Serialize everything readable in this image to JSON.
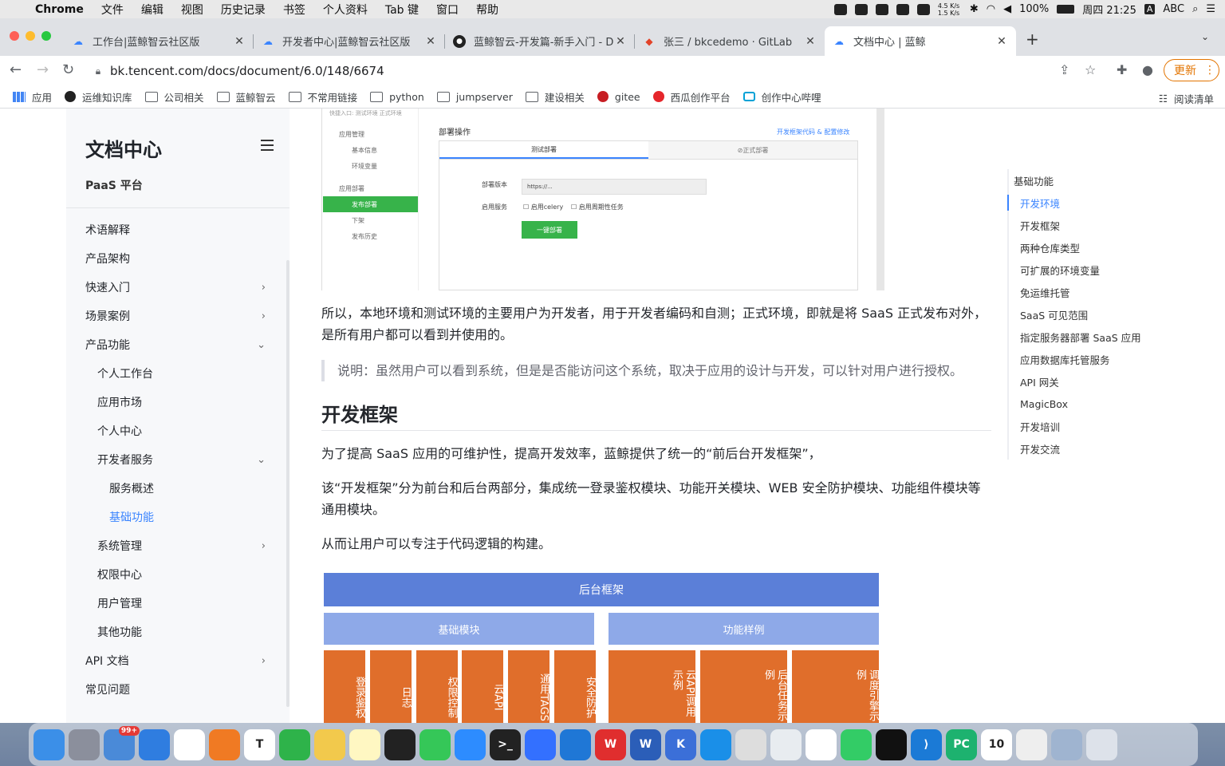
{
  "menubar": {
    "app_name": "Chrome",
    "items": [
      "文件",
      "编辑",
      "视图",
      "历史记录",
      "书签",
      "个人资料",
      "Tab 键",
      "窗口",
      "帮助"
    ],
    "net_speed": "4.5 K/s 1.5 K/s",
    "battery": "100%",
    "clock": "周四 21:25",
    "input_method": "ABC"
  },
  "tabs": [
    {
      "title": "工作台|蓝鲸智云社区版",
      "icon": "cloud-icon"
    },
    {
      "title": "开发者中心|蓝鲸智云社区版",
      "icon": "cloud-icon"
    },
    {
      "title": "蓝鲸智云-开发篇-新手入门 - Dev",
      "icon": "github-icon"
    },
    {
      "title": "张三 / bkcedemo · GitLab",
      "icon": "gitlab-icon"
    },
    {
      "title": "文档中心 | 蓝鲸",
      "icon": "cloud-icon"
    }
  ],
  "toolbar": {
    "url": "bk.tencent.com/docs/document/6.0/148/6674",
    "update_label": "更新"
  },
  "bookmarks": [
    "应用",
    "运维知识库",
    "公司相关",
    "蓝鲸智云",
    "不常用链接",
    "python",
    "jumpserver",
    "建设相关",
    "gitee",
    "西瓜创作平台",
    "创作中心哔哩"
  ],
  "reading_list": "阅读清单",
  "sidebar": {
    "title": "文档中心",
    "subtitle": "PaaS 平台",
    "items": [
      {
        "label": "术语解释",
        "level": 1,
        "chevron": ""
      },
      {
        "label": "产品架构",
        "level": 1,
        "chevron": ""
      },
      {
        "label": "快速入门",
        "level": 1,
        "chevron": "›"
      },
      {
        "label": "场景案例",
        "level": 1,
        "chevron": "›"
      },
      {
        "label": "产品功能",
        "level": 1,
        "chevron": "⌄"
      },
      {
        "label": "个人工作台",
        "level": 2,
        "chevron": ""
      },
      {
        "label": "应用市场",
        "level": 2,
        "chevron": ""
      },
      {
        "label": "个人中心",
        "level": 2,
        "chevron": ""
      },
      {
        "label": "开发者服务",
        "level": 2,
        "chevron": "⌄"
      },
      {
        "label": "服务概述",
        "level": 3,
        "chevron": ""
      },
      {
        "label": "基础功能",
        "level": 3,
        "chevron": "",
        "active": true
      },
      {
        "label": "系统管理",
        "level": 2,
        "chevron": "›"
      },
      {
        "label": "权限中心",
        "level": 2,
        "chevron": ""
      },
      {
        "label": "用户管理",
        "level": 2,
        "chevron": ""
      },
      {
        "label": "其他功能",
        "level": 2,
        "chevron": ""
      },
      {
        "label": "API 文档",
        "level": 1,
        "chevron": "›"
      },
      {
        "label": "常见问题",
        "level": 1,
        "chevron": ""
      }
    ]
  },
  "screenshot": {
    "crumb": "快捷入口:   测试环境   正式环境",
    "left_menu": [
      "应用管理",
      "基本信息",
      "环境变量",
      "应用部署",
      "发布部署",
      "下架",
      "发布历史"
    ],
    "section": "部署操作",
    "link": "开发框架代码 & 配置修改",
    "tab_test": "测试部署",
    "tab_prod": "⊘正式部署",
    "version_label": "部署版本",
    "version_value": "https://...",
    "service_label": "启用服务",
    "celery": "启用celery",
    "periodic": "启用周期性任务",
    "deploy_btn": "一键部署"
  },
  "content": {
    "para1": "所以，本地环境和测试环境的主要用户为开发者，用于开发者编码和自测；正式环境，即就是将 SaaS 正式发布对外，是所有用户都可以看到并使用的。",
    "note": "说明：虽然用户可以看到系统，但是是否能访问这个系统，取决于应用的设计与开发，可以针对用户进行授权。",
    "h2": "开发框架",
    "para2": "为了提高 SaaS 应用的可维护性，提高开发效率，蓝鲸提供了统一的“前后台开发框架”，",
    "para3": "该“开发框架”分为前台和后台两部分，集成统一登录鉴权模块、功能开关模块、WEB 安全防护模块、功能组件模块等通用模块。",
    "para4": "从而让用户可以专注于代码逻辑的构建。"
  },
  "diagram": {
    "top": "后台框架",
    "left": "基础模块",
    "right": "功能样例",
    "left_cols": [
      "登录鉴权",
      "日志",
      "权限控制",
      "云API",
      "通用TAGS",
      "安全防护"
    ],
    "right_cols": [
      "云API调用示例",
      "后台任务示例",
      "调度引擎示例"
    ],
    "colors": {
      "top": "#5b7fd8",
      "sub": "#8ea9e8",
      "col": "#e06e2b"
    }
  },
  "toc": {
    "head": "基础功能",
    "items": [
      "开发环境",
      "开发框架",
      "两种仓库类型",
      "可扩展的环境变量",
      "免运维托管",
      "SaaS 可见范围",
      "指定服务器部署 SaaS 应用",
      "应用数据库托管服务",
      "API 网关",
      "MagicBox",
      "开发培训",
      "开发交流"
    ]
  },
  "dock": [
    "finder-icon",
    "launchpad-icon",
    "qq-icon",
    "safari-icon",
    "chrome-icon",
    "firefox-icon",
    "typora-icon",
    "evernote-icon",
    "photos-icon",
    "notes-icon",
    "qq-penguin-icon",
    "wechat-icon",
    "zoom-icon",
    "terminal-icon",
    "lark-icon",
    "teamviewer-icon",
    "wps-icon",
    "word-icon",
    "k-icon",
    "tool-icon",
    "textedit-icon",
    "disk-icon",
    "baidu-icon",
    "infuse-icon",
    "iterm-icon",
    "vscode-icon",
    "pycharm-icon",
    "calendar-icon",
    "paper-icon",
    "preview-icon",
    "trash-icon"
  ],
  "dock_badge": "99+",
  "calendar_day": "10"
}
